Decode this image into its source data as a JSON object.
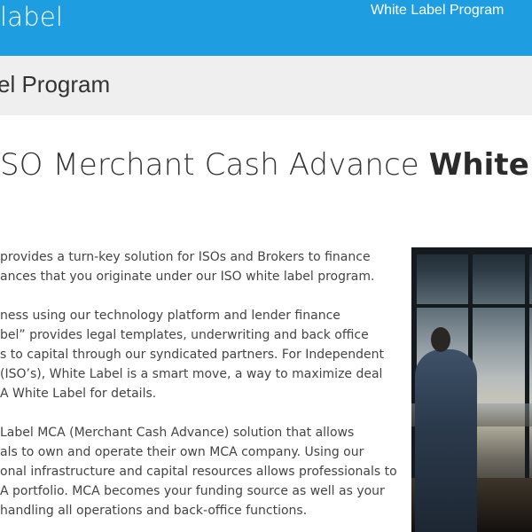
{
  "header": {
    "logo_text": "label",
    "nav_link": "White Label Program"
  },
  "breadcrumb": {
    "title": "el Program"
  },
  "main": {
    "heading_light": "SO Merchant Cash Advance ",
    "heading_bold": "White",
    "paragraphs": [
      [
        "provides a turn-key solution for ISOs and Brokers to finance",
        "ances that you originate under our ISO white label program."
      ],
      [
        "ness using our technology platform and lender finance",
        "bel” provides legal templates, underwriting and back office",
        "s to capital through our syndicated partners. For Independent",
        "(ISO’s), White Label is a smart move, a way to maximize deal",
        "A White Label for details."
      ],
      [
        "Label MCA (Merchant Cash Advance) solution that allows",
        "als to own and operate their own MCA company. Using our",
        "onal infrastructure and capital resources allows professionals to",
        "A portfolio. MCA becomes your funding source as well as your",
        "handling all operations and back-office functions."
      ]
    ]
  },
  "colors": {
    "header_bg": "#1e9de0",
    "crumb_bg": "#efefef",
    "text": "#444444"
  },
  "photo": {
    "subject": "businessman on phone by office window"
  }
}
